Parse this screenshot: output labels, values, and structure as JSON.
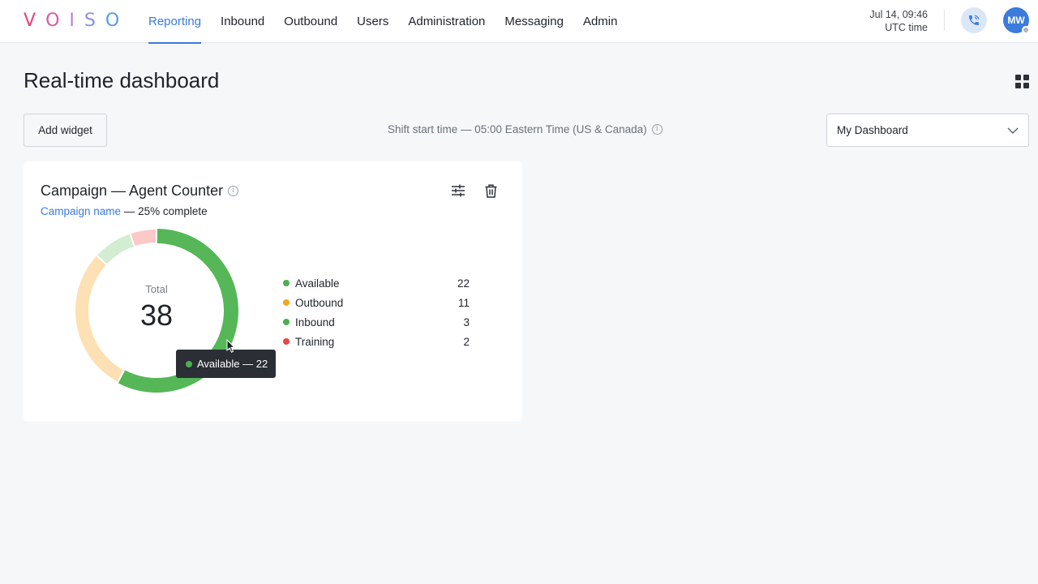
{
  "logo": {
    "letters": [
      "V",
      "O",
      "I",
      "S",
      "O"
    ],
    "colors": [
      "#e8407a",
      "#d65aa6",
      "#b77fd8",
      "#8e8fe6",
      "#5a9be8"
    ]
  },
  "nav": {
    "items": [
      {
        "label": "Reporting",
        "active": true
      },
      {
        "label": "Inbound",
        "active": false
      },
      {
        "label": "Outbound",
        "active": false
      },
      {
        "label": "Users",
        "active": false
      },
      {
        "label": "Administration",
        "active": false
      },
      {
        "label": "Messaging",
        "active": false
      },
      {
        "label": "Admin",
        "active": false
      }
    ],
    "accent": "#3b7bdc"
  },
  "header": {
    "date_time": "Jul 14, 09:46",
    "timezone": "UTC time",
    "avatar_initials": "MW",
    "phone_icon": "phone-icon"
  },
  "page": {
    "title": "Real-time dashboard",
    "add_widget_label": "Add widget",
    "shift_text": "Shift start time — 05:00 Eastern Time (US & Canada)",
    "dashboard_select": "My Dashboard"
  },
  "widget": {
    "title": "Campaign — Agent Counter",
    "campaign_link": "Campaign name",
    "progress_text": "— 25% complete",
    "total_label": "Total",
    "total_value": "38",
    "tooltip_text": "Available — 22",
    "legend": [
      {
        "name": "Available",
        "value": "22",
        "color": "#4caf50"
      },
      {
        "name": "Outbound",
        "value": "11",
        "color": "#f5a623"
      },
      {
        "name": "Inbound",
        "value": "3",
        "color": "#4caf50"
      },
      {
        "name": "Training",
        "value": "2",
        "color": "#e84545"
      }
    ]
  },
  "chart_data": {
    "type": "pie",
    "categories": [
      "Available",
      "Outbound",
      "Inbound",
      "Training"
    ],
    "values": [
      22,
      11,
      3,
      2
    ],
    "colors": [
      "#55b757",
      "#fde0b4",
      "#d2edd1",
      "#fcc8c8"
    ],
    "title": "Campaign — Agent Counter",
    "total": 38
  }
}
